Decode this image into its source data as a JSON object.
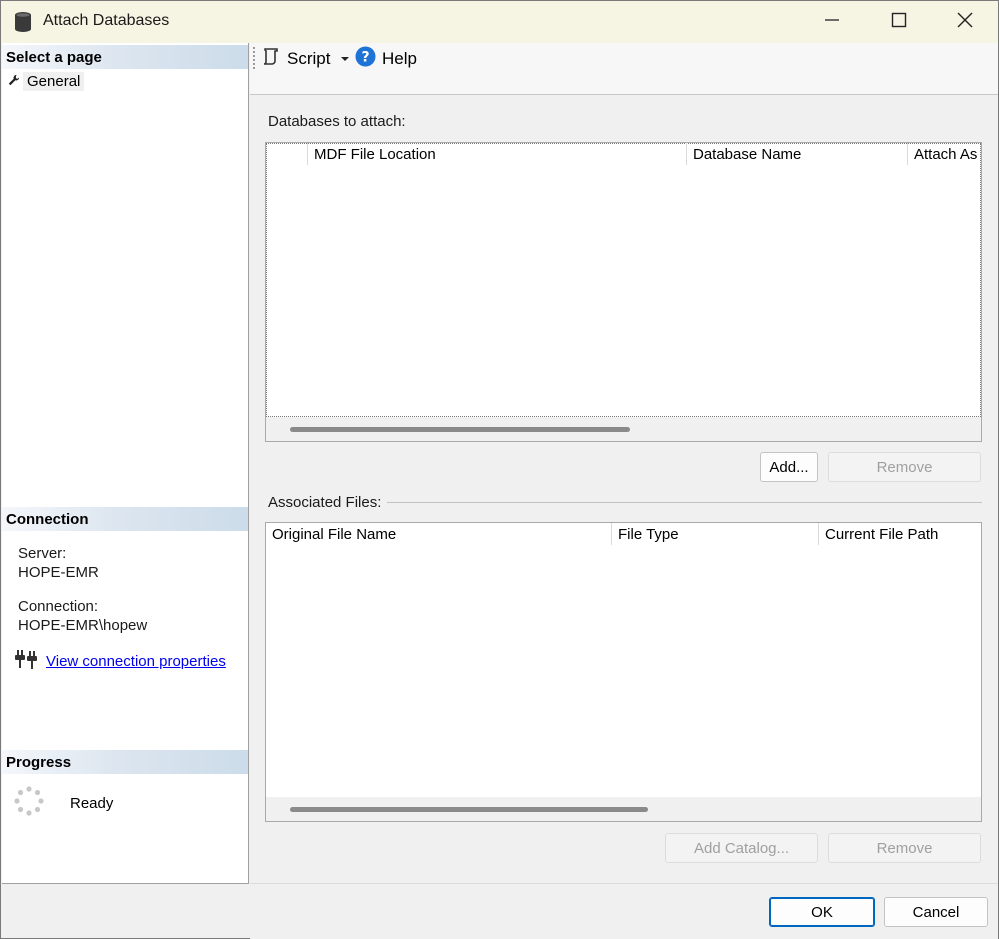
{
  "window": {
    "title": "Attach Databases",
    "icon": "database-icon"
  },
  "left": {
    "select_page_header": "Select a page",
    "nav_items": [
      {
        "label": "General",
        "icon": "wrench-icon"
      }
    ],
    "connection_header": "Connection",
    "server_label": "Server:",
    "server_value": "HOPE-EMR",
    "connection_label": "Connection:",
    "connection_value": "HOPE-EMR\\hopew",
    "view_props_link": "View connection properties",
    "progress_header": "Progress",
    "progress_status": "Ready"
  },
  "toolbar": {
    "script_label": "Script",
    "help_label": "Help"
  },
  "attach": {
    "group_label": "Databases to attach:",
    "columns": [
      "",
      "MDF File Location",
      "Database Name",
      "Attach As"
    ],
    "rows": [],
    "add_button": "Add...",
    "remove_button": "Remove"
  },
  "associated": {
    "group_label": "Associated Files:",
    "columns": [
      "Original File Name",
      "File Type",
      "Current File Path"
    ],
    "rows": [],
    "add_catalog_button": "Add Catalog...",
    "remove_button": "Remove"
  },
  "footer": {
    "ok_button": "OK",
    "cancel_button": "Cancel"
  },
  "colors": {
    "titlebar_bg": "#f6f5e3",
    "link": "#0000ee",
    "default_button_border": "#0067c0"
  }
}
